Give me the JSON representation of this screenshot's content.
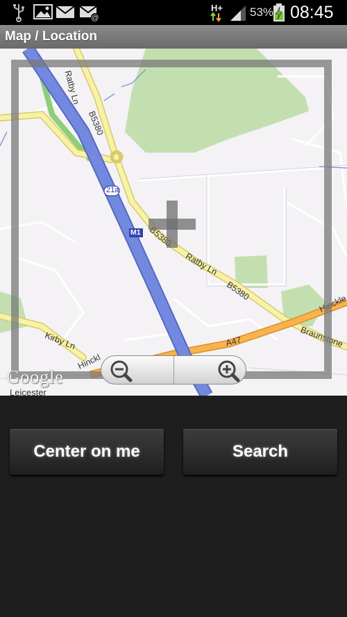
{
  "statusbar": {
    "icons": [
      "usb-icon",
      "gallery-icon",
      "email-icon",
      "email-at-icon",
      "network-hplus-icon",
      "signal-icon",
      "battery-charging-icon"
    ],
    "network_type": "H+",
    "battery_percent": "53%",
    "time": "08:45"
  },
  "titlebar": {
    "title": "Map / Location"
  },
  "map": {
    "labels": {
      "ratby_ln_top": "Ratby Ln",
      "b5380_top": "B5380",
      "junction": "21a",
      "m1": "M1",
      "b5380_mid": "B5380",
      "ratby_ln_mid": "Ratby Ln",
      "b5380_low": "B5380",
      "hinckley_right": "Hinckle",
      "braunstone": "Braunstone",
      "kirby_ln": "Kirby Ln",
      "a47": "A47",
      "hinckley_left": "Hinckl",
      "leicester": "Leicester"
    },
    "logo": "Google",
    "zoom_out": "zoom-out-icon",
    "zoom_in": "zoom-in-icon"
  },
  "actions": {
    "center_label": "Center on me",
    "search_label": "Search"
  },
  "colors": {
    "motorway": "#6b7fd6",
    "a_road": "#f6b04a",
    "b_road": "#f6ee9c",
    "park": "#bfdca6"
  }
}
